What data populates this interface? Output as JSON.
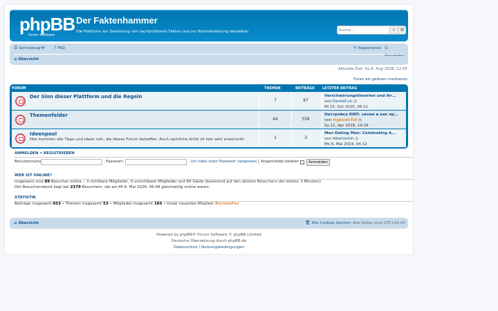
{
  "header": {
    "logo_text": "phpBB",
    "logo_sub": "forum  software",
    "site_title": "Der Faktenhammer",
    "site_desc": "Die Plattform zur Sammlung von nachprüfbaren Fakten und zur Kommentierung derselben",
    "search_placeholder": "Suche..."
  },
  "nav": {
    "quicklinks": "Schnellzugriff",
    "faq": "FAQ",
    "register": "Registrieren",
    "login": "Anmelden",
    "breadcrumb_home": "Übersicht"
  },
  "time_line": "Aktuelle Zeit: Sa 8. Aug 2026, 12:05",
  "mark_read": "Foren als gelesen markieren",
  "table_head": {
    "forum": "FORUM",
    "topics": "THEMEN",
    "posts": "BEITRÄGE",
    "last_post": "LETZTER BEITRAG"
  },
  "forums": [
    {
      "title": "Der Sinn dieser Plattform und die Regeln",
      "desc": "",
      "topics": "7",
      "posts": "87",
      "last_title": "Verschwörungstheorien und ihr…",
      "by_prefix": "von",
      "last_author": "DanielCuh",
      "last_date": "Mi 15. Oct 2025, 06:11"
    },
    {
      "title": "Themenfelder",
      "desc": "",
      "topics": "44",
      "posts": "558",
      "last_title": "Настройка КИП: зачем и как пр…",
      "by_prefix": "von",
      "last_author": "mgkoelsTut",
      "last_date": "Sa 11. Apr 2026, 19:24"
    },
    {
      "title": "Ideenpool",
      "desc": "Hier kommen alle Tipps und Ideen rein, die dieses Forum betreffen. Auch sachliche Kritik ist hier sehr erwünscht.",
      "topics": "1",
      "posts": "3",
      "last_title": "Men Dating Men: Celebrating A…",
      "by_prefix": "von",
      "last_author": "Albertinfuh",
      "last_date": "Mo 6. Mai 2024, 04:12"
    }
  ],
  "login": {
    "title_login": "ANMELDEN",
    "title_sep": "•",
    "title_register": "REGISTRIEREN",
    "username_label": "Benutzername:",
    "password_label": "Passwort:",
    "forgot": "Ich habe mein Passwort vergessen",
    "pipe": "|",
    "remember": "Angemeldet bleiben",
    "submit": "Anmelden"
  },
  "online": {
    "title": "WER IST ONLINE?",
    "line1_a": "Insgesamt sind",
    "line1_count": "89",
    "line1_b": "Besucher online :: 0 sichtbare Mitglieder, 0 unsichtbare Mitglieder und 89 Gäste (basierend auf den aktiven Besuchern der letzten 3 Minuten)",
    "line2_a": "Der Besucherrekord liegt bei",
    "line2_count": "2379",
    "line2_b": "Besuchern, die am Mi 6. Mai 2026, 06:48 gleichzeitig online waren."
  },
  "stats": {
    "title": "STATISTIK",
    "posts_label": "Beiträge insgesamt",
    "posts": "653",
    "topics_label": "• Themen insgesamt",
    "topics": "53",
    "members_label": "• Mitglieder insgesamt",
    "members": "165",
    "newest_label": "• Unser neuestes Mitglied:",
    "newest": "BoriazePex"
  },
  "footer": {
    "home": "Übersicht",
    "delete_cookies": "Alle Cookies löschen",
    "timezone": "Alle Zeiten sind UTC+02:00",
    "powered": "Powered by phpBB® Forum Software © phpBB Limited",
    "translation": "Deutsche Übersetzung durch phpBB.de",
    "privacy": "Datenschutz",
    "pipe": "|",
    "terms": "Nutzungsbedingungen"
  },
  "colors": {
    "header_blue": "#12a3eb",
    "nav_bg": "#cadceb",
    "link": "#105289",
    "unread_icon": "#d14e5e",
    "newest_member": "#e58c3c"
  }
}
